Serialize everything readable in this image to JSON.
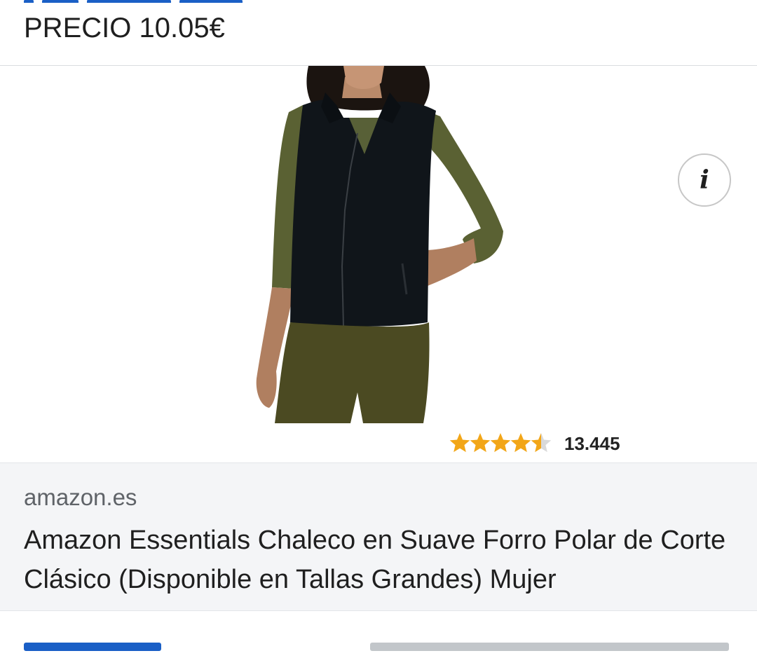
{
  "header": {
    "price_text": "PRECIO 10.05€"
  },
  "image": {
    "info_symbol": "i",
    "rating": 4.5,
    "rating_max": 5,
    "review_count": "13.445",
    "star_color": "#f2a618"
  },
  "result": {
    "domain": "amazon.es",
    "title": "Amazon Essentials Chaleco en Suave Forro Polar de Corte Clásico (Disponible en Tallas Grandes) Mujer"
  },
  "colors": {
    "link": "#1a5fc6",
    "card_bg": "#f4f5f7"
  }
}
